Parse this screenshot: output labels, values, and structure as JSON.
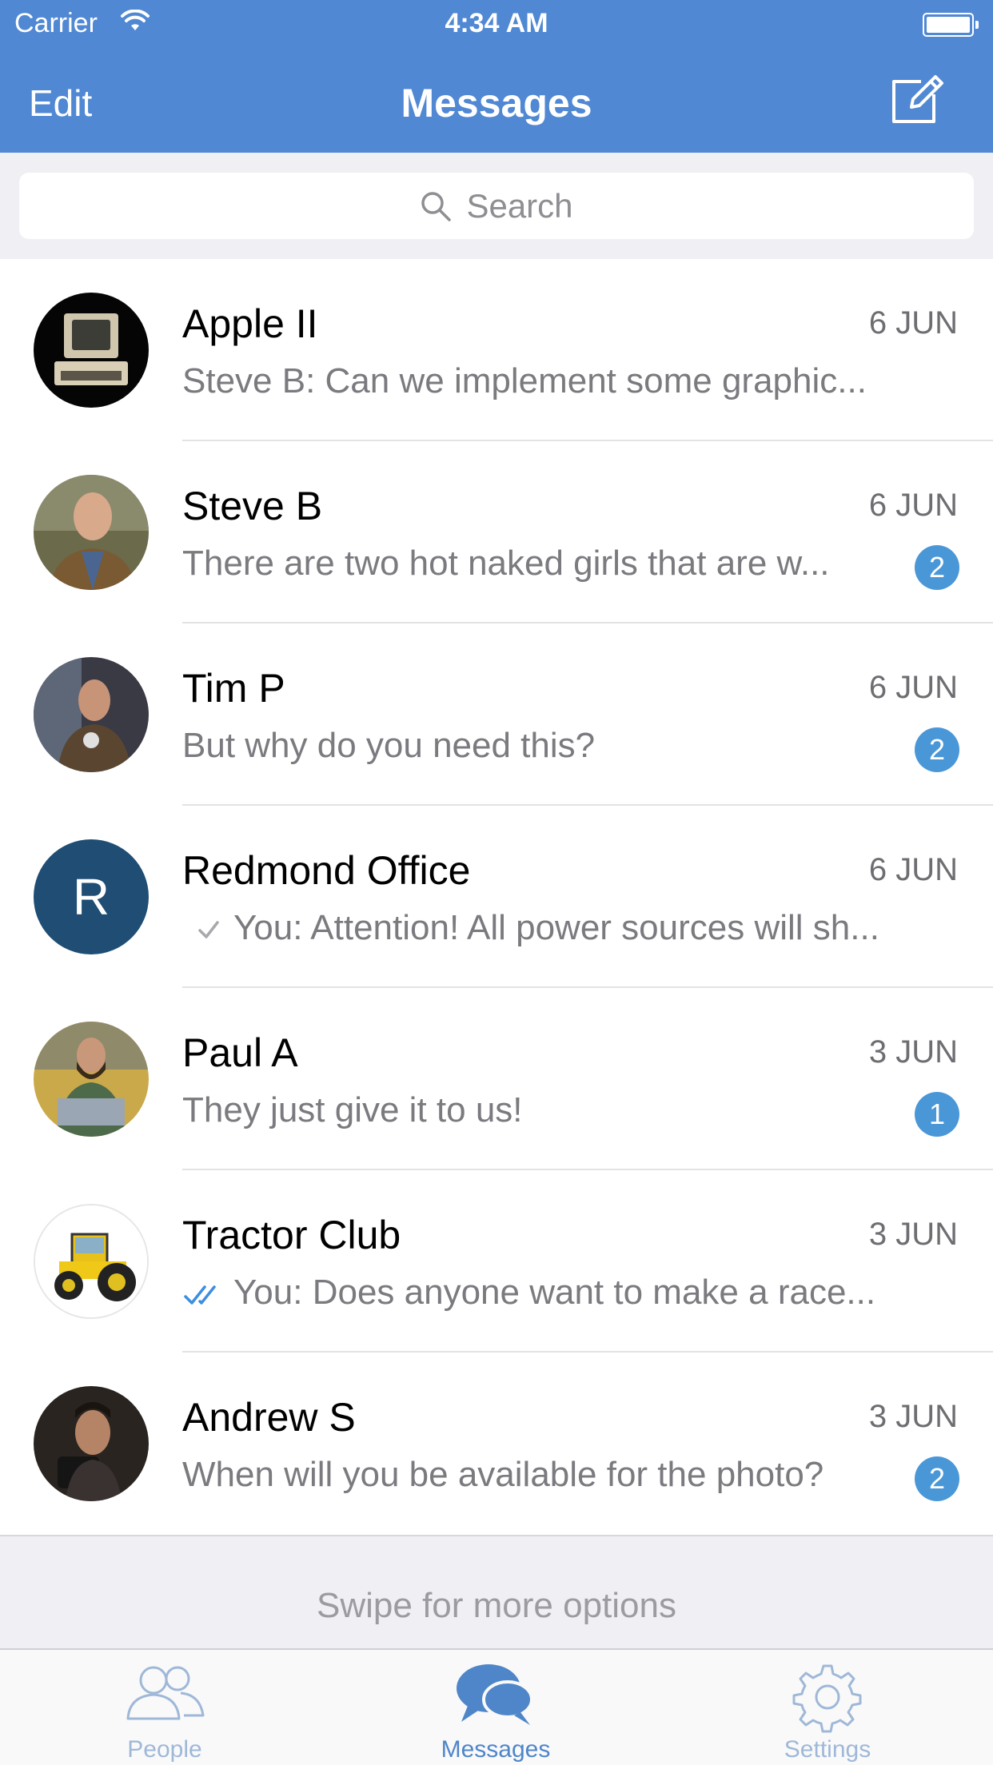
{
  "status_bar": {
    "carrier": "Carrier",
    "time": "4:34 AM"
  },
  "nav": {
    "edit_label": "Edit",
    "title": "Messages",
    "compose_icon": "compose-icon"
  },
  "search": {
    "placeholder": "Search"
  },
  "chats": [
    {
      "name": "Apple II",
      "date": "6 JUN",
      "preview": "Steve B: Can we implement some graphic...",
      "badge": null,
      "avatar": "photo"
    },
    {
      "name": "Steve B",
      "date": "6 JUN",
      "preview": "There are two hot naked girls that are w...",
      "badge": "2",
      "avatar": "photo"
    },
    {
      "name": "Tim P",
      "date": "6 JUN",
      "preview": "But why do you need this?",
      "badge": "2",
      "avatar": "photo"
    },
    {
      "name": "Redmond Office",
      "date": "6 JUN",
      "preview": "You: Attention! All power sources will sh...",
      "badge": null,
      "avatar_letter": "R",
      "status": "sent"
    },
    {
      "name": "Paul A",
      "date": "3 JUN",
      "preview": "They just give it to us!",
      "badge": "1",
      "avatar": "photo"
    },
    {
      "name": "Tractor Club",
      "date": "3 JUN",
      "preview": "You: Does anyone want to make a race...",
      "badge": null,
      "avatar": "photo",
      "status": "read"
    },
    {
      "name": "Andrew S",
      "date": "3 JUN",
      "preview": "When will you be available for the photo?",
      "badge": "2",
      "avatar": "photo"
    }
  ],
  "swipe_hint": "Swipe for more options",
  "tabs": [
    {
      "label": "People",
      "icon": "people-icon",
      "active": false
    },
    {
      "label": "Messages",
      "icon": "messages-icon",
      "active": true
    },
    {
      "label": "Settings",
      "icon": "settings-icon",
      "active": false
    }
  ],
  "colors": {
    "header": "#5088d3",
    "badge": "#4a97d8",
    "tab_active": "#4f86c9",
    "tab_inactive": "#9fb8d8",
    "redmond_avatar": "#1f4d73"
  }
}
